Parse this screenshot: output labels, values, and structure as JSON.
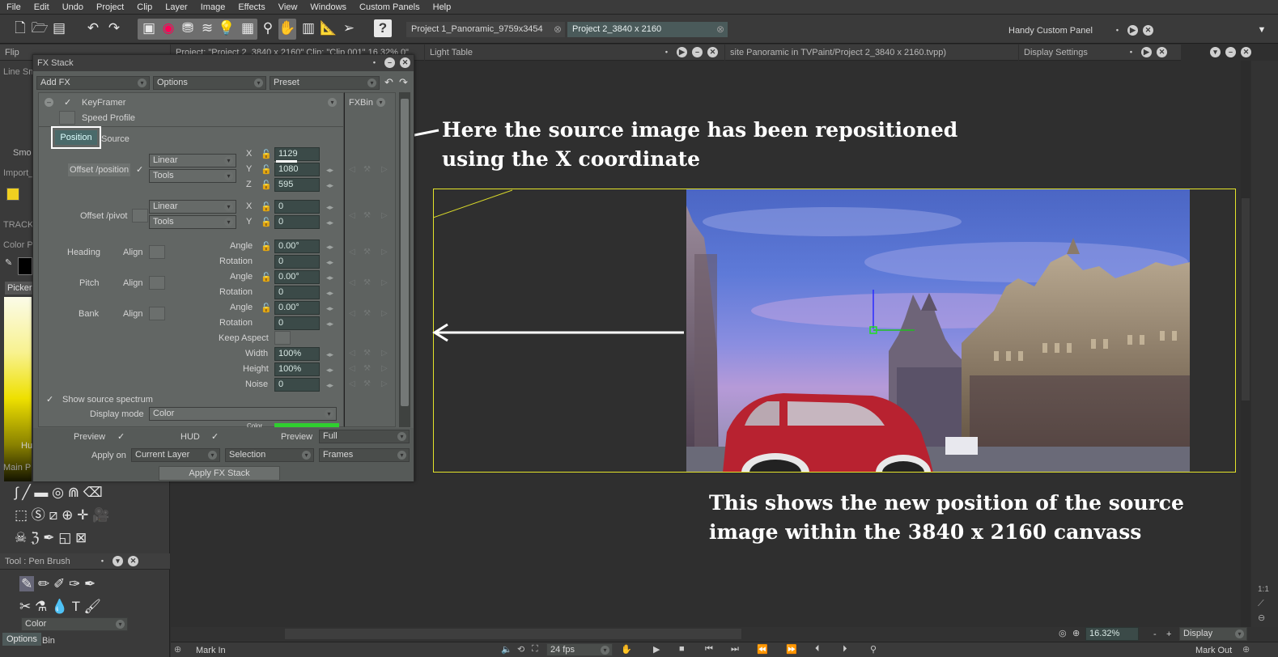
{
  "menu": [
    "File",
    "Edit",
    "Undo",
    "Project",
    "Clip",
    "Layer",
    "Image",
    "Effects",
    "View",
    "Windows",
    "Custom Panels",
    "Help"
  ],
  "tabs": [
    {
      "label": "Project 1_Panoramic_9759x3454",
      "active": false
    },
    {
      "label": "Project 2_3840 x 2160",
      "active": true
    }
  ],
  "custom_panel": {
    "label": "Handy Custom Panel"
  },
  "left_panels": {
    "flip": "Flip",
    "project_info": "Project: \"Project 2_3840 x 2160\"  Clip: \"Clip 001\"  16.32%  0\"",
    "line_smoothing": "Line Sm",
    "smooth": "Smo",
    "import": "Import_",
    "track": "TRACK",
    "color": "Color P",
    "picker": "Picker",
    "hue": "Hu",
    "main_panel": "Main P",
    "tool_panel": "Tool : Pen Brush",
    "color_dropdown": "Color",
    "options_tab": "Options",
    "bin_tab": "Bin"
  },
  "light_table": {
    "title": "Light Table"
  },
  "path_title": "site Panoramic in TVPaint/Project 2_3840 x 2160.tvpp)",
  "display_settings": {
    "title": "Display Settings"
  },
  "fx_stack": {
    "title": "FX Stack",
    "add_fx": "Add FX",
    "options": "Options",
    "preset": "Preset",
    "fxbin": "FXBin",
    "keyframer": "KeyFramer",
    "speed_profile": "Speed Profile",
    "tab_position": "Position",
    "tab_source": "Source",
    "offset_position": {
      "label": "Offset /position",
      "interp": "Linear",
      "tools": "Tools",
      "x_label": "X",
      "x": "1129",
      "y_label": "Y",
      "y": "1080",
      "z_label": "Z",
      "z": "595"
    },
    "offset_pivot": {
      "label": "Offset /pivot",
      "interp": "Linear",
      "tools": "Tools",
      "x_label": "X",
      "x": "0",
      "y_label": "Y",
      "y": "0"
    },
    "heading": {
      "label": "Heading",
      "align": "Align",
      "angle_label": "Angle",
      "angle": "0.00°",
      "rotation_label": "Rotation",
      "rotation": "0"
    },
    "pitch": {
      "label": "Pitch",
      "align": "Align",
      "angle_label": "Angle",
      "angle": "0.00°",
      "rotation_label": "Rotation",
      "rotation": "0"
    },
    "bank": {
      "label": "Bank",
      "align": "Align",
      "angle_label": "Angle",
      "angle": "0.00°",
      "rotation_label": "Rotation",
      "rotation": "0"
    },
    "keep_aspect": "Keep Aspect",
    "width_label": "Width",
    "width": "100%",
    "height_label": "Height",
    "height": "100%",
    "noise_label": "Noise",
    "noise": "0",
    "show_source_spectrum": "Show source spectrum",
    "display_mode_label": "Display mode",
    "display_mode": "Color",
    "color_label": "Color",
    "preview_label": "Preview",
    "hud_label": "HUD",
    "preview2_label": "Preview",
    "preview_mode": "Full",
    "apply_on_label": "Apply on",
    "apply_on": "Current Layer",
    "selection": "Selection",
    "frames": "Frames",
    "apply_button": "Apply FX Stack"
  },
  "annotations": {
    "top_line1": "Here the source image has been repositioned",
    "top_line2": "using the X coordinate",
    "bottom_line1": "This shows the new position of the source",
    "bottom_line2": "image within the 3840 x 2160 canvass"
  },
  "bottom": {
    "zoom": "16.32%",
    "display_button": "Display",
    "minus": "-",
    "plus": "+",
    "mark_in": "Mark In",
    "fps": "24 fps",
    "mark_out": "Mark Out"
  },
  "colors": {
    "canvas_border": "#e4e42a",
    "active_tab": "#4a5a5a",
    "field_bg": "#3b4a48",
    "spectrum_green": "#2fcf2f",
    "car_red": "#b82230"
  }
}
